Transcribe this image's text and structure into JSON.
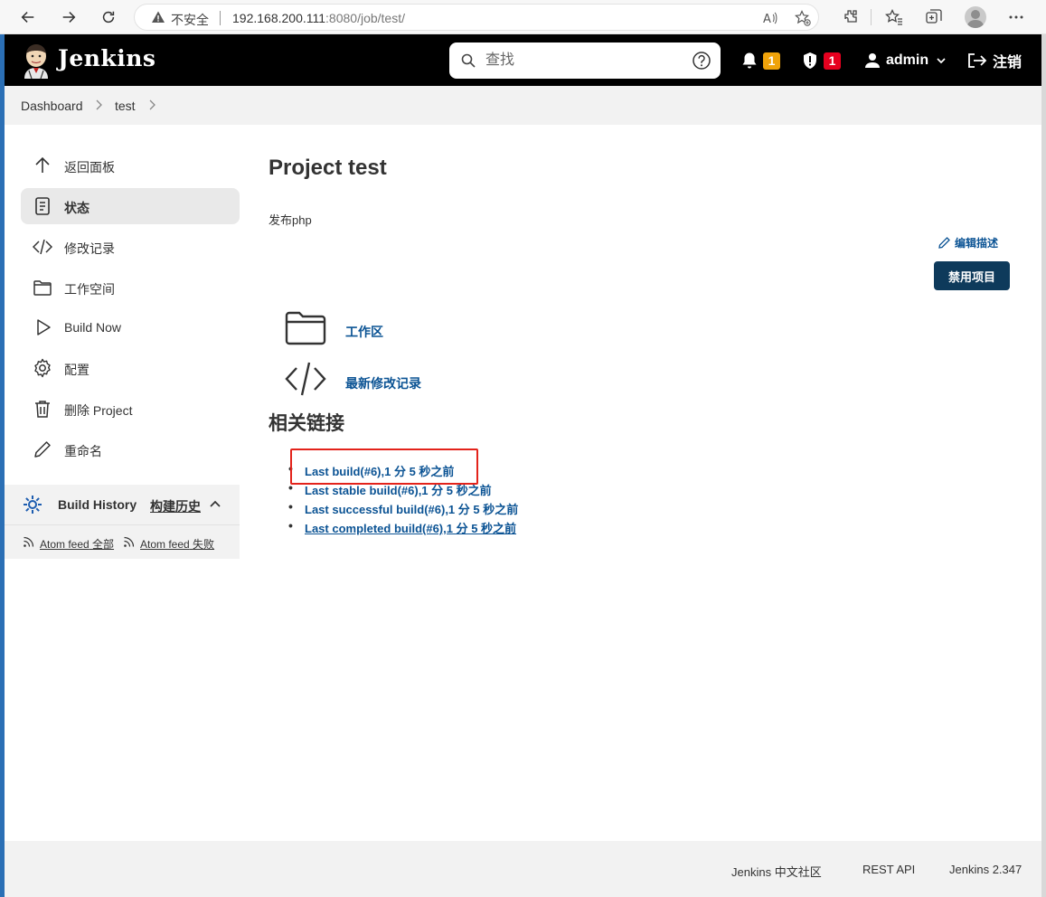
{
  "browser": {
    "insecure_label": "不安全",
    "url_host": "192.168.200.111",
    "url_rest": ":8080/job/test/"
  },
  "header": {
    "brand": "Jenkins",
    "search_placeholder": "查找",
    "notifications_count": "1",
    "security_count": "1",
    "user": "admin",
    "logout": "注销"
  },
  "breadcrumb": {
    "items": [
      "Dashboard",
      "test"
    ]
  },
  "sidebar": {
    "tasks": [
      {
        "label": "返回面板",
        "icon": "arrow-up-icon"
      },
      {
        "label": "状态",
        "icon": "document-icon"
      },
      {
        "label": "修改记录",
        "icon": "code-icon"
      },
      {
        "label": "工作空间",
        "icon": "folder-icon"
      },
      {
        "label": "Build Now",
        "icon": "play-icon"
      },
      {
        "label": "配置",
        "icon": "gear-icon"
      },
      {
        "label": "删除 Project",
        "icon": "trash-icon"
      },
      {
        "label": "重命名",
        "icon": "pencil-icon"
      }
    ],
    "build_history": {
      "title": "Build History",
      "trend": "构建历史",
      "feed_all_prefix": "Atom feed",
      "feed_all": "全部",
      "feed_failed_prefix": "Atom feed",
      "feed_failed": "失败"
    }
  },
  "main": {
    "title": "Project test",
    "description": "发布php",
    "edit_description": "编辑描述",
    "disable_button": "禁用项目",
    "links": [
      {
        "label": "工作区",
        "icon": "folder-icon"
      },
      {
        "label": "最新修改记录",
        "icon": "code-icon"
      }
    ],
    "related_title": "相关链接",
    "permalinks": [
      "Last build(#6),1 分 5 秒之前",
      "Last stable build(#6),1 分 5 秒之前",
      "Last successful build(#6),1 分 5 秒之前",
      "Last completed build(#6),1 分 5 秒之前"
    ]
  },
  "footer": {
    "community": "Jenkins 中文社区",
    "rest_api": "REST API",
    "version": "Jenkins 2.347"
  },
  "colors": {
    "header_bg": "#000000",
    "link": "#0b5394",
    "primary_button": "#0e3a5b",
    "badge_warning": "#f0a30a",
    "badge_danger": "#e6001f",
    "highlight": "#e3231b"
  }
}
